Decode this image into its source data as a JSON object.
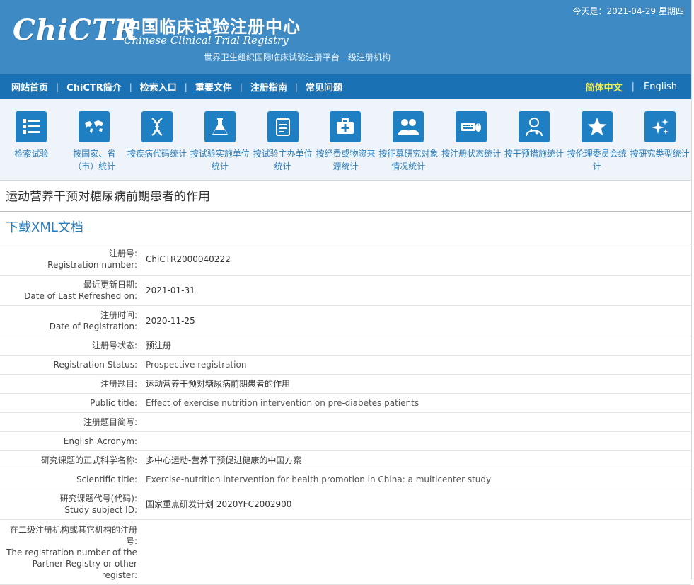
{
  "header": {
    "logo": "ChiCTR",
    "title_cn": "中国临床试验注册中心",
    "title_en": "Chinese Clinical Trial Registry",
    "subtitle": "世界卫生组织国际临床试验注册平台一级注册机构",
    "date": "今天是：2021-04-29 星期四"
  },
  "nav": {
    "items": [
      "网站首页",
      "ChiCTR简介",
      "检索入口",
      "重要文件",
      "注册指南",
      "常见问题"
    ],
    "lang_cn": "简体中文",
    "lang_en": "English"
  },
  "icons": [
    {
      "label": "检索试验",
      "icon": "list-numbered-icon"
    },
    {
      "label": "按国家、省（市）统计",
      "icon": "world-map-icon"
    },
    {
      "label": "按疾病代码统计",
      "icon": "dna-icon"
    },
    {
      "label": "按试验实施单位统计",
      "icon": "flask-icon"
    },
    {
      "label": "按试验主办单位统计",
      "icon": "clipboard-icon"
    },
    {
      "label": "按经费或物资来源统计",
      "icon": "medical-kit-icon"
    },
    {
      "label": "按征募研究对象情况统计",
      "icon": "people-icon"
    },
    {
      "label": "按注册状态统计",
      "icon": "keyboard-mouse-icon"
    },
    {
      "label": "按干预措施统计",
      "icon": "doctor-icon"
    },
    {
      "label": "按伦理委员会统计",
      "icon": "star-icon"
    },
    {
      "label": "按研究类型统计",
      "icon": "sparkle-icon"
    }
  ],
  "page_title": "运动营养干预对糖尿病前期患者的作用",
  "download_label": "下载XML文档",
  "fields": [
    {
      "label_cn": "注册号:",
      "label_en": "Registration number:",
      "value": "ChiCTR2000040222"
    },
    {
      "label_cn": "最近更新日期:",
      "label_en": "Date of Last Refreshed on:",
      "value": "2021-01-31"
    },
    {
      "label_cn": "注册时间:",
      "label_en": "Date of Registration:",
      "value": "2020-11-25"
    },
    {
      "label_cn": "注册号状态:",
      "label_en": "",
      "value": "预注册"
    },
    {
      "label_cn": "",
      "label_en": "Registration Status:",
      "value": "Prospective registration"
    },
    {
      "label_cn": "注册题目:",
      "label_en": "",
      "value": "运动营养干预对糖尿病前期患者的作用"
    },
    {
      "label_cn": "",
      "label_en": "Public title:",
      "value": "Effect of exercise nutrition intervention on pre-diabetes patients"
    },
    {
      "label_cn": "注册题目简写:",
      "label_en": "",
      "value": ""
    },
    {
      "label_cn": "",
      "label_en": "English Acronym:",
      "value": ""
    },
    {
      "label_cn": "研究课题的正式科学名称:",
      "label_en": "",
      "value": "多中心运动-营养干预促进健康的中国方案"
    },
    {
      "label_cn": "",
      "label_en": "Scientific title:",
      "value": "Exercise-nutrition intervention for health promotion in China: a multicenter study"
    },
    {
      "label_cn": "研究课题代号(代码):",
      "label_en": "Study subject ID:",
      "value": "国家重点研发计划 2020YFC2002900"
    },
    {
      "label_cn": "在二级注册机构或其它机构的注册号:",
      "label_en": "The registration number of the Partner Registry or other register:",
      "value": ""
    }
  ]
}
